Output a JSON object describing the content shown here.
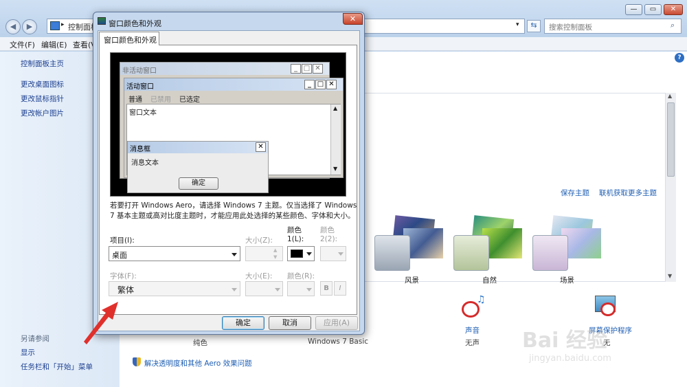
{
  "explorer": {
    "address": "控制面板",
    "search_placeholder": "搜索控制面板",
    "menu": [
      "文件(F)",
      "编辑(E)",
      "查看(V"
    ],
    "left_links": [
      "控制面板主页",
      "更改桌面图标",
      "更改鼠标指针",
      "更改帐户图片"
    ],
    "see_also": "另请参阅",
    "see_also_links": [
      "显示",
      "任务栏和「开始」菜单"
    ],
    "links": {
      "save_theme": "保存主题",
      "more_themes": "联机获取更多主题"
    },
    "themes": [
      "风景",
      "自然",
      "场景"
    ],
    "bottom": {
      "plain": "纯色",
      "win7basic": "Windows 7 Basic",
      "sound": "声音",
      "sound_value": "无声",
      "screensaver": "屏幕保护程序",
      "screensaver_value": "无",
      "troubleshoot": "解决透明度和其他 Aero 效果问题"
    },
    "help": "?"
  },
  "dialog": {
    "title": "窗口颜色和外观",
    "tab": "窗口颜色和外观",
    "close": "✕",
    "preview": {
      "inactive_title": "非活动窗口",
      "active_title": "活动窗口",
      "menu": [
        "普通",
        "已禁用",
        "已选定"
      ],
      "window_text": "窗口文本",
      "msgbox_title": "消息框",
      "msgbox_text": "消息文本",
      "ok": "确定"
    },
    "info_line1": "若要打开 Windows Aero，请选择 Windows 7 主题。仅当选择了 Windows",
    "info_line2": "7 基本主题或高对比度主题时，才能应用此处选择的某些颜色、字体和大小。",
    "labels": {
      "item": "项目(I):",
      "size_z": "大小(Z):",
      "color1_a": "颜色",
      "color1_b": "1(L):",
      "color2_a": "颜色",
      "color2_b": "2(2):",
      "font": "字体(F):",
      "size_e": "大小(E):",
      "color_r": "颜色(R):",
      "bold": "B",
      "italic": "I"
    },
    "values": {
      "item": "桌面",
      "font": "繁体",
      "color1": "#000000"
    },
    "buttons": {
      "ok": "确定",
      "cancel": "取消",
      "apply": "应用(A)"
    }
  },
  "watermark": {
    "brand": "Bai 经验",
    "url": "jingyan.baidu.com"
  }
}
